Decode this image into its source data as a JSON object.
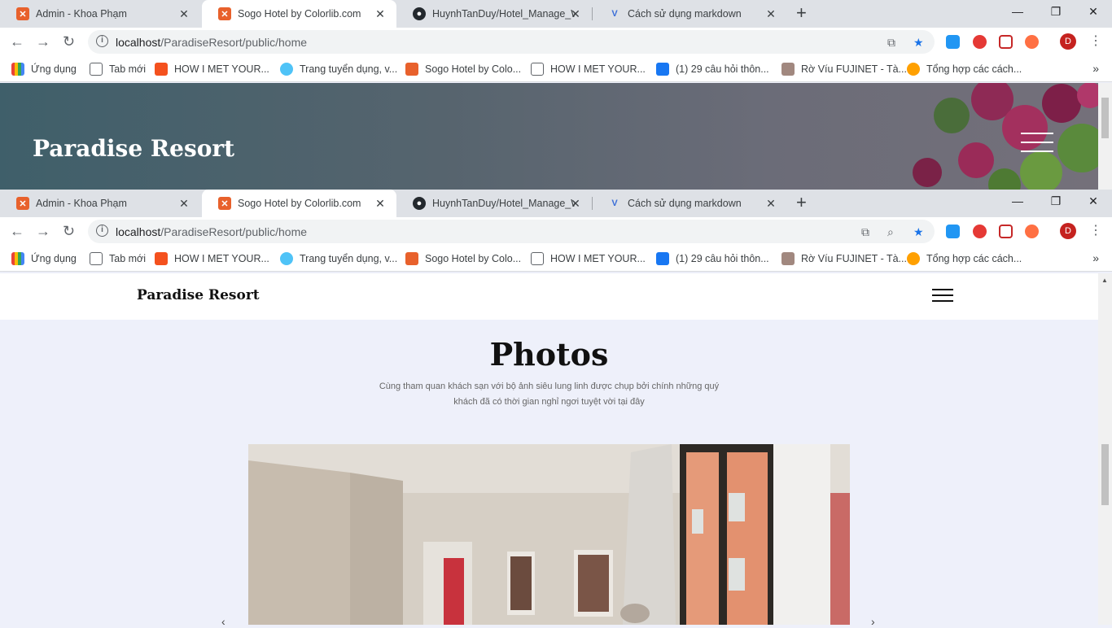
{
  "browser": {
    "tabs": [
      {
        "title": "Admin - Khoa Phạm",
        "icon": "xampp-icon",
        "color": "#e8612c"
      },
      {
        "title": "Sogo Hotel by Colorlib.com",
        "icon": "xampp-icon",
        "color": "#e8612c"
      },
      {
        "title": "HuynhTanDuy/Hotel_Manage_We",
        "icon": "github-icon",
        "color": "#24292e"
      },
      {
        "title": "Cách sử dụng markdown",
        "icon": "v-icon",
        "color": "#3b6ed8"
      }
    ],
    "url_host": "localhost",
    "url_path": "/ParadiseResort/public/home",
    "avatar_letter": "D",
    "bookmarks": [
      {
        "label": "Ứng dụng",
        "icon": "apps-icon"
      },
      {
        "label": "Tab mới",
        "icon": "page-icon"
      },
      {
        "label": "HOW I MET YOUR...",
        "icon": "film-icon"
      },
      {
        "label": "Trang tuyển dụng, v...",
        "icon": "jobs-icon"
      },
      {
        "label": "Sogo Hotel by Colo...",
        "icon": "xampp-icon"
      },
      {
        "label": "HOW I MET YOUR...",
        "icon": "page-icon"
      },
      {
        "label": "(1) 29 câu hỏi thôn...",
        "icon": "facebook-icon"
      },
      {
        "label": "Rờ Víu FUJINET - Tà...",
        "icon": "cat-icon"
      },
      {
        "label": "Tổng hợp các cách...",
        "icon": "a-icon"
      }
    ]
  },
  "hero": {
    "brand": "Paradise Resort"
  },
  "site": {
    "brand": "Paradise Resort",
    "section_title": "Photos",
    "section_subtitle_line1": "Cùng tham quan khách sạn với bộ ảnh siêu lung linh được chụp bởi chính những quý",
    "section_subtitle_line2": "khách đã có thời gian nghỉ ngơi tuyệt vời tại đây"
  }
}
